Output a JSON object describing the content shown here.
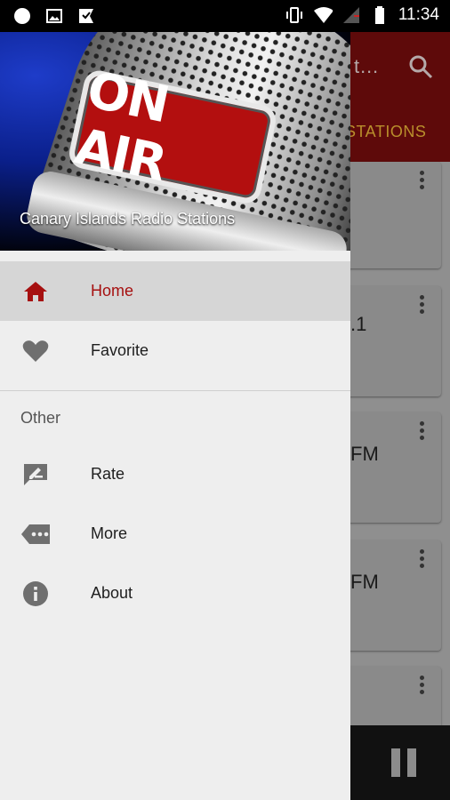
{
  "status_bar": {
    "time": "11:34"
  },
  "background": {
    "title_fragment": "t…",
    "tab_fragment": "STATIONS",
    "card_fragments": [
      "",
      ".1",
      "FM",
      "FM",
      ""
    ]
  },
  "drawer": {
    "header_title": "Canary Islands Radio Stations",
    "header_badge": "ON AIR",
    "items": [
      {
        "label": "Home",
        "icon": "home-icon"
      },
      {
        "label": "Favorite",
        "icon": "heart-icon"
      }
    ],
    "section_label": "Other",
    "other_items": [
      {
        "label": "Rate",
        "icon": "rate-icon"
      },
      {
        "label": "More",
        "icon": "more-icon"
      },
      {
        "label": "About",
        "icon": "info-icon"
      }
    ]
  },
  "colors": {
    "accent": "#a61010",
    "toolbar": "#8b1414"
  }
}
